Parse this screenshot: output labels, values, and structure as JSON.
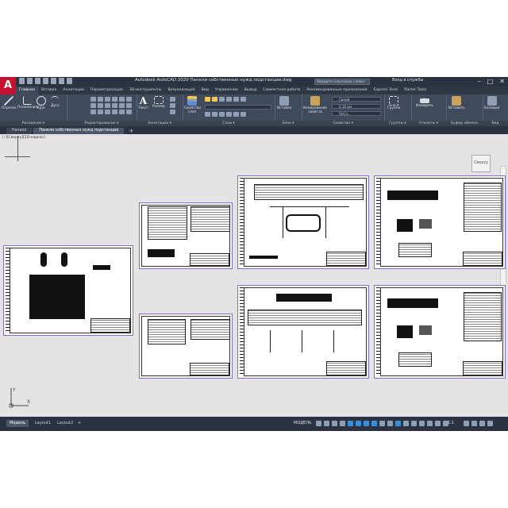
{
  "app": {
    "logo": "A",
    "title": "Autodesk AutoCAD 2020   Панели собственных нужд подстанции.dwg",
    "search_placeholder": "Введите ключевое слово/фразу",
    "signin": "Вход в службы",
    "window_controls": [
      "–",
      "□",
      "✕"
    ]
  },
  "ribbon": {
    "tabs": [
      "Главная",
      "Вставка",
      "Аннотации",
      "Параметризация",
      "3D-инструменты",
      "Визуализация",
      "Вид",
      "Управление",
      "Вывод",
      "Совместная работа",
      "Рекомендованные приложения",
      "Express Tools",
      "Raster Tools"
    ],
    "active_tab": 0,
    "panels": {
      "draw": {
        "title": "Рисование ▾",
        "tools": [
          "Отрезок",
          "Полилиния",
          "Круг",
          "Дуга"
        ]
      },
      "modify": {
        "title": "Редактирование ▾"
      },
      "annotation": {
        "title": "Аннотации ▾",
        "tools": [
          "Текст",
          "Размер"
        ]
      },
      "layers": {
        "title": "Слои ▾",
        "tools": [
          "Свойства слоя"
        ]
      },
      "block": {
        "title": "Блок ▾",
        "tools": [
          "Вставка"
        ]
      },
      "properties": {
        "title": "Свойства ▾",
        "tools": [
          "Копирование свойств"
        ],
        "color": "Синий",
        "lineweight": "0,18 мм",
        "linetype": "ПоСл..."
      },
      "groups": {
        "title": "Группы ▾",
        "tools": [
          "Группа"
        ]
      },
      "utilities": {
        "title": "Утилиты ▾",
        "tools": [
          "Измерить"
        ]
      },
      "clipboard": {
        "title": "Буфер обмена",
        "tools": [
          "Вставить"
        ]
      },
      "base": {
        "title": "Вид",
        "tools": [
          "Базовый"
        ]
      }
    }
  },
  "file_tabs": {
    "items": [
      "Начало",
      "Панели собственных нужд подстанции"
    ],
    "active": 1,
    "add": "+"
  },
  "viewport": {
    "label": "[–][Сверху][2D-каркас]",
    "viewcube": "Сверху",
    "ucs": {
      "y": "Y",
      "x": "X"
    }
  },
  "status": {
    "layout_tabs": [
      "Модель",
      "Layout1",
      "Layout2"
    ],
    "active_layout": 0,
    "add": "+",
    "model": "МОДЕЛЬ",
    "scale": "1:1"
  },
  "colors": {
    "brand": "#c8102e",
    "ribbon_bg": "#3f4a5a",
    "titlebar_bg": "#2b3340",
    "canvas_bg": "#e4e4e4",
    "sheet_border": "#7a72c8",
    "status_icon_active": "#3b8fd9"
  },
  "icons": {
    "qat": [
      "new-icon",
      "open-icon",
      "save-icon",
      "saveas-icon",
      "print-icon",
      "undo-icon",
      "redo-icon"
    ],
    "status": [
      "grid-icon",
      "snap-icon",
      "ortho-icon",
      "polar-icon",
      "osnap-icon",
      "otrack-icon",
      "lineweight-icon",
      "transparency-icon",
      "selection-cycling-icon",
      "annotation-scale-icon",
      "workspace-icon",
      "customize-icon"
    ]
  }
}
